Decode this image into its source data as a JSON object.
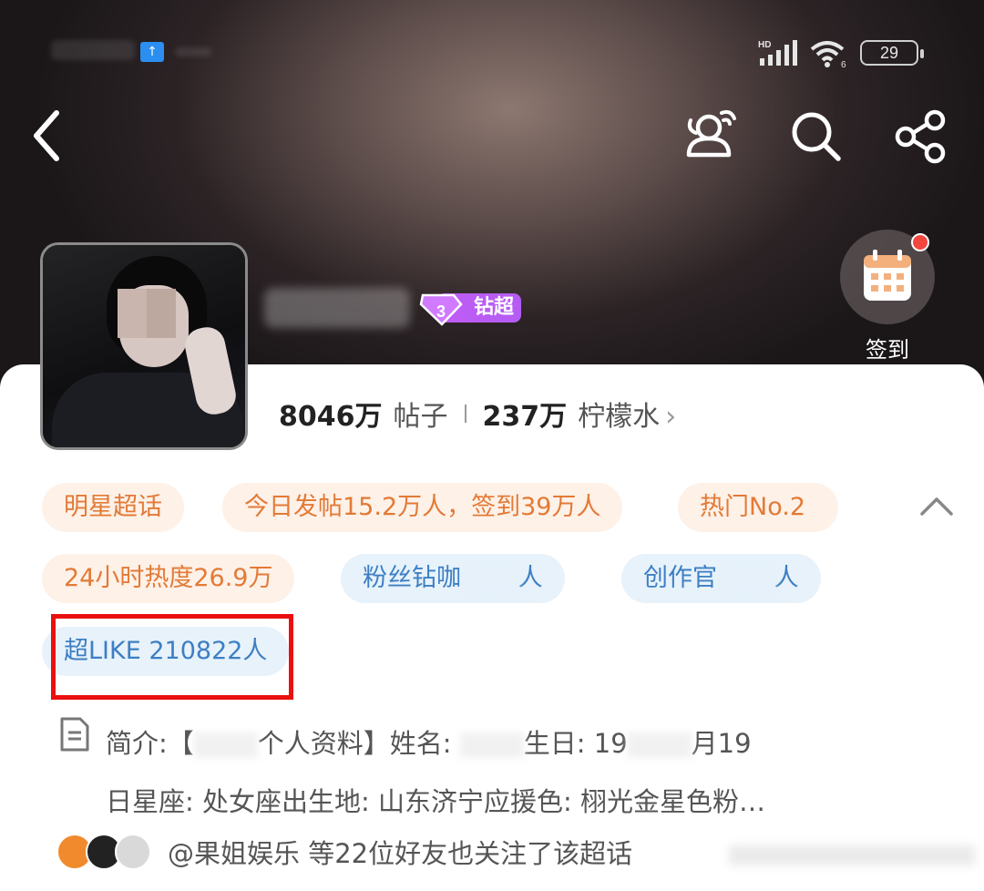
{
  "status_bar": {
    "battery": "29",
    "wifi_label": "6",
    "signal_label": "HD"
  },
  "header": {
    "back_icon": "chevron-left-icon",
    "actions": [
      "chat-bubbles-icon",
      "search-icon",
      "share-icon"
    ]
  },
  "profile": {
    "badge_level": "3",
    "badge_label": "钻超"
  },
  "checkin": {
    "label": "签到",
    "icon": "calendar-icon"
  },
  "stats": {
    "posts_value": "8046万",
    "posts_label": "帖子",
    "fans_value": "237万",
    "fans_label": "柠檬水",
    "chevron": "›"
  },
  "tags": {
    "row1": [
      "明星超话",
      "今日发帖15.2万人，签到39万人",
      "热门No.2"
    ],
    "row2": [
      "24小时热度26.9万",
      "粉丝钻咖",
      "创作官",
      "人"
    ],
    "row3": [
      "超LIKE 210822人"
    ]
  },
  "intro": {
    "line1_a": "简介:【",
    "line1_b": "个人资料】姓名:",
    "line1_c": "生日: 19",
    "line1_d": "月19",
    "line2": "日星座: 处女座出生地: 山东济宁应援色: 栩光金星色粉…"
  },
  "friends": {
    "text": "@果姐娱乐 等22位好友也关注了该超话"
  },
  "colors": {
    "orange_tag_text": "#e37a36",
    "blue_tag_text": "#3d7fc3",
    "highlight_border": "#ea1010",
    "badge_purple": "#b45cf3"
  }
}
